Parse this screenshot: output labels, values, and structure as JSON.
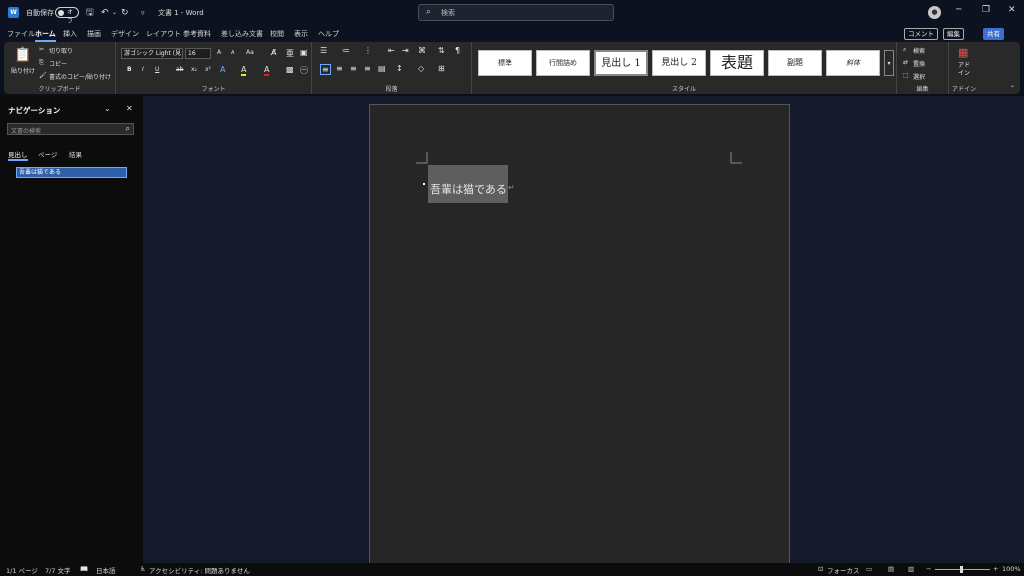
{
  "titlebar": {
    "app_badge": "W",
    "autosave_label": "自動保存",
    "autosave_state": "オフ",
    "doc_title": "文書 1  -  Word",
    "search_placeholder": "検索",
    "qat_customize": "▿",
    "save_icon": "save-icon",
    "undo_icon": "undo-icon",
    "redo_icon": "redo-icon"
  },
  "tabs": [
    "ファイル",
    "ホーム",
    "挿入",
    "描画",
    "デザイン",
    "レイアウト",
    "参考資料",
    "差し込み文書",
    "校閲",
    "表示",
    "ヘルプ"
  ],
  "active_tab": "ホーム",
  "header_buttons": {
    "comment": "コメント",
    "edit": "編集",
    "share": "共有"
  },
  "ribbon": {
    "clipboard": {
      "label": "クリップボード",
      "paste": "貼り付け",
      "cut": "切り取り",
      "copy": "コピー",
      "format_painter": "書式のコピー/貼り付け"
    },
    "font": {
      "label": "フォント",
      "font_name": "游ゴシック Light (見",
      "font_size": "16",
      "bold": "B",
      "italic": "I",
      "underline": "U",
      "strike": "ab",
      "sub": "x₂",
      "sup": "x²",
      "grow": "A",
      "shrink": "A",
      "case": "Aa",
      "effects": "A",
      "highlight": "A",
      "color": "A"
    },
    "paragraph": {
      "label": "段落"
    },
    "styles": {
      "label": "スタイル",
      "items": [
        "標準",
        "行間詰め",
        "見出し 1",
        "見出し 2",
        "表題",
        "副題",
        "斜体"
      ]
    },
    "editing": {
      "label": "編集",
      "find": "検索",
      "replace": "置換",
      "select": "選択"
    },
    "addins": {
      "label": "アドイン",
      "button": "アド\nイン"
    }
  },
  "nav_pane": {
    "title": "ナビゲーション",
    "search_placeholder": "文書の検索",
    "tabs": [
      "見出し",
      "ページ",
      "結果"
    ],
    "heading_item": "吾輩は猫である"
  },
  "document": {
    "text": "吾輩は猫である",
    "para_mark": "↵"
  },
  "statusbar": {
    "page": "1/1 ページ",
    "words": "7/7 文字",
    "language": "日本語",
    "accessibility": "アクセシビリティ: 問題ありません",
    "focus": "フォーカス",
    "zoom": "100%",
    "zoom_minus": "−",
    "zoom_plus": "+"
  },
  "colors": {
    "accent": "#6ea8ff",
    "share": "#3c6fd1",
    "word_blue": "#2b7cd3"
  }
}
